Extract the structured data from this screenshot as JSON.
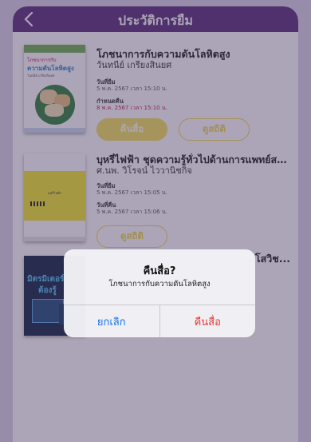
{
  "nav": {
    "title": "ประวัติการยืม"
  },
  "books": [
    {
      "title": "โภชนาการกับความดันโลหิตสูง",
      "author": "วันทนีย์ เกรียงสินยศ",
      "cover_title_line1": "โภชนาการกับ",
      "cover_title_line2": "ความดันโลหิตสูง",
      "cover_author": "วันทนีย์ เกรียงสินยศ",
      "borrow_label": "วันที่ยืม",
      "borrow_value": "5 พ.ค. 2567 เวลา 15:10 น.",
      "due_label": "กำหนดคืน",
      "due_value": "8 พ.ค. 2567 เวลา 15:10 น.",
      "return_button": "คืนสื่อ",
      "detail_button": "ดูสถิติ"
    },
    {
      "title": "บุหรี่ไฟฟ้า ชุดความรู้ทั่วไปด้านการแพทย์สา...",
      "author": "ศ.นพ. วิโรจน์ ไววานิชกิจ",
      "cover_title": "บุหรี่ไฟฟ้า",
      "borrow_label": "วันที่ยืม",
      "borrow_value": "5 พ.ค. 2567 เวลา 15:05 น.",
      "return_label": "วันที่คืน",
      "return_value": "5 พ.ค. 2567 เวลา 15:06 น.",
      "detail_button": "ดูสถิติ"
    },
    {
      "title_tail": "...โสวิช...",
      "cover_title_line1": "มิตรมิเตอร์",
      "cover_title_line2": "ต้องรู้"
    }
  ],
  "dialog": {
    "title": "คืนสื่อ?",
    "message": "โภชนาการกับความดันโลหิตสูง",
    "cancel": "ยกเลิก",
    "confirm": "คืนสื่อ"
  }
}
